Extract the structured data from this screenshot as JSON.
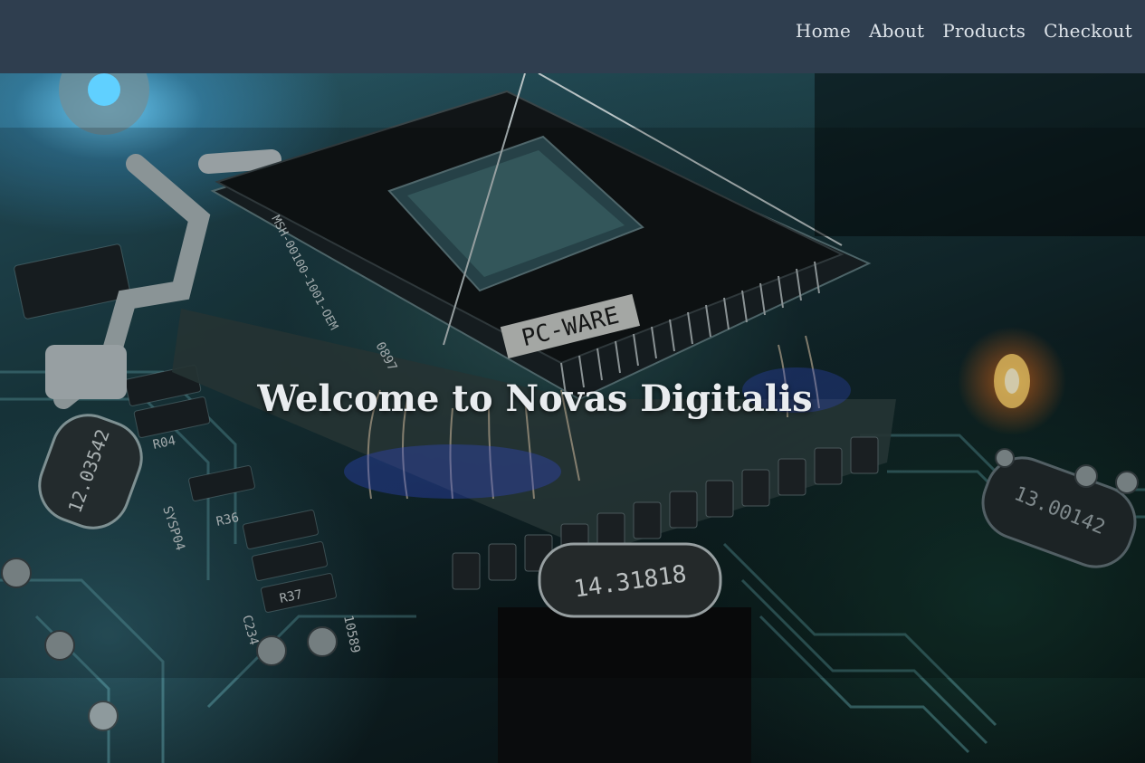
{
  "nav": {
    "items": [
      {
        "label": "Home"
      },
      {
        "label": "About"
      },
      {
        "label": "Products"
      },
      {
        "label": "Checkout"
      }
    ]
  },
  "hero": {
    "title": "Welcome to Novas Digitalis",
    "chip_label": "PC-WARE",
    "crystal_1": "14.31818",
    "crystal_2": "12.03542",
    "crystal_3": "13.00142",
    "chip_code": "MSH-00100-1001-OEM",
    "labels": [
      "R37",
      "R36",
      "R04",
      "0897",
      "SYSP04",
      "C234",
      "10589"
    ]
  },
  "colors": {
    "nav_bg": "#2f3e4f",
    "nav_text": "#dde3e9",
    "title_text": "#e9ecef"
  }
}
